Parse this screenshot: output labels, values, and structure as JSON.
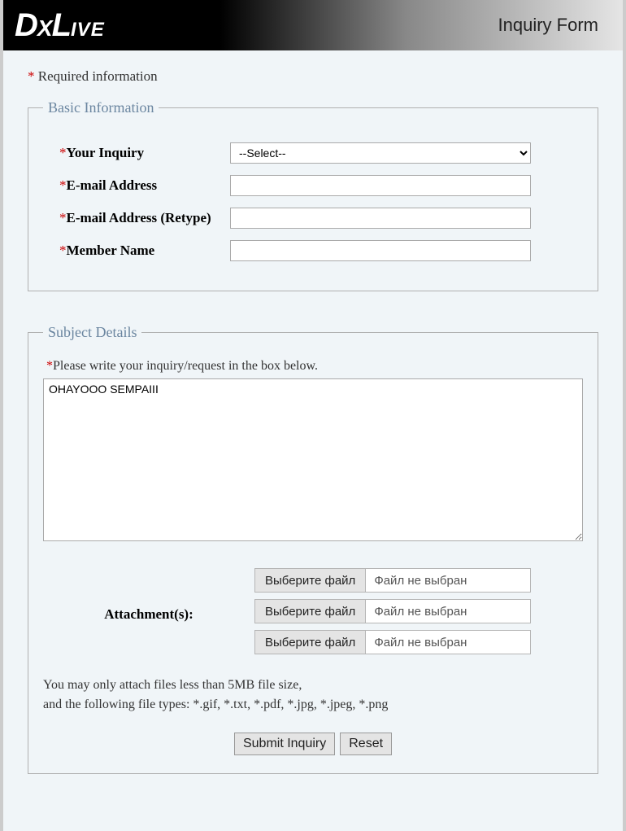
{
  "header": {
    "logo_text": "DXLIVE",
    "title": "Inquiry Form"
  },
  "required_note": "Required information",
  "basic": {
    "legend": "Basic Information",
    "inquiry_label": "Your Inquiry",
    "inquiry_selected": "--Select--",
    "email_label": "E-mail Address",
    "email_value": "",
    "email2_label": "E-mail Address (Retype)",
    "email2_value": "",
    "member_label": "Member Name",
    "member_value": ""
  },
  "subject": {
    "legend": "Subject Details",
    "note": "Please write your inquiry/request in the box below.",
    "textarea_value": "OHAYOOO SEMPAIII",
    "attach_label": "Attachment(s):",
    "file_button": "Выберите файл",
    "file_status": "Файл не выбран",
    "file_note_line1": "You may only attach files less than 5MB file size,",
    "file_note_line2": "and the following file types: *.gif, *.txt, *.pdf, *.jpg, *.jpeg, *.png"
  },
  "buttons": {
    "submit": "Submit Inquiry",
    "reset": "Reset"
  }
}
